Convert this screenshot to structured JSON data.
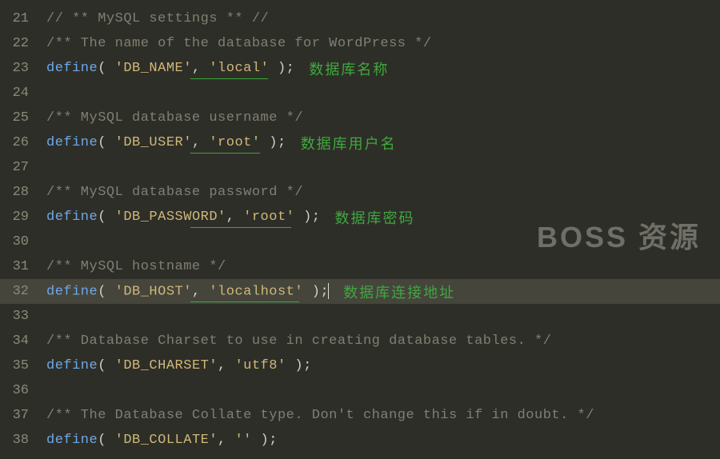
{
  "watermark": "BOSS 资源",
  "annotations": {
    "db_name": "数据库名称",
    "db_user": "数据库用户名",
    "db_password": "数据库密码",
    "db_host": "数据库连接地址"
  },
  "lines": [
    {
      "n": 21,
      "type": "comment",
      "text": "// ** MySQL settings ** //"
    },
    {
      "n": 22,
      "type": "comment",
      "text": "/** The name of the database for WordPress */"
    },
    {
      "n": 23,
      "type": "define",
      "key": "'DB_NAME'",
      "val": "'local'",
      "annot_key": "db_name",
      "underline": true
    },
    {
      "n": 24,
      "type": "blank"
    },
    {
      "n": 25,
      "type": "comment",
      "text": "/** MySQL database username */"
    },
    {
      "n": 26,
      "type": "define",
      "key": "'DB_USER'",
      "val": "'root'",
      "annot_key": "db_user",
      "underline": true
    },
    {
      "n": 27,
      "type": "blank"
    },
    {
      "n": 28,
      "type": "comment",
      "text": "/** MySQL database password */"
    },
    {
      "n": 29,
      "type": "define",
      "key": "'DB_PASSWORD'",
      "val": "'root'",
      "annot_key": "db_password",
      "underline": true
    },
    {
      "n": 30,
      "type": "blank"
    },
    {
      "n": 31,
      "type": "comment",
      "text": "/** MySQL hostname */"
    },
    {
      "n": 32,
      "type": "define",
      "key": "'DB_HOST'",
      "val": "'localhost'",
      "annot_key": "db_host",
      "underline": true,
      "current": true,
      "cursor": true
    },
    {
      "n": 33,
      "type": "blank"
    },
    {
      "n": 34,
      "type": "comment",
      "text": "/** Database Charset to use in creating database tables. */"
    },
    {
      "n": 35,
      "type": "define",
      "key": "'DB_CHARSET'",
      "val": "'utf8'"
    },
    {
      "n": 36,
      "type": "blank"
    },
    {
      "n": 37,
      "type": "comment",
      "text": "/** The Database Collate type. Don't change this if in doubt. */"
    },
    {
      "n": 38,
      "type": "define",
      "key": "'DB_COLLATE'",
      "val": "''"
    }
  ],
  "tokens": {
    "define": "define",
    "open": "( ",
    "sep": ", ",
    "close": " );"
  }
}
